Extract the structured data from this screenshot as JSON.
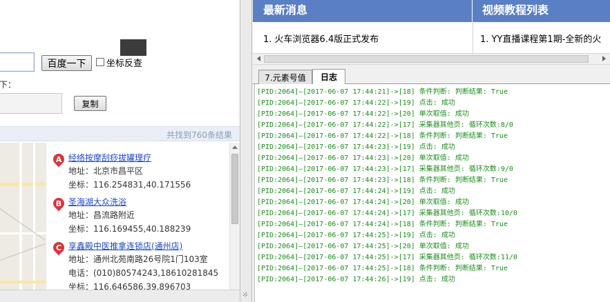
{
  "left": {
    "search_button": "百度一下",
    "reverse_checkbox_label": "坐标反查",
    "result_prefix": "下：",
    "copy_button": "复制",
    "result_count": "共找到760条结果",
    "results": [
      {
        "marker": "A",
        "title": "经络按摩刮痧拔罐理疗",
        "lines": [
          "地址：北京市昌平区",
          "坐标：116.254831,40.171556"
        ]
      },
      {
        "marker": "B",
        "title": "圣海湖大众洗浴",
        "lines": [
          "地址：昌流路附近",
          "坐标：116.169455,40.188239"
        ]
      },
      {
        "marker": "C",
        "title": "享鑫殿中医推拿连锁店(通州店)",
        "lines": [
          "地址：通州北苑南路26号院1门103室",
          "电话：(010)80574243,18610281845",
          "坐标：116.646586,39.896703"
        ]
      }
    ]
  },
  "right": {
    "news_header": "最新消息",
    "video_header": "视频教程列表",
    "news_item": "1. 火车浏览器6.4版正式发布",
    "video_item": "1. YY直播课程第1期-全新的火",
    "tabs": [
      {
        "label": "7.元素号值",
        "active": false
      },
      {
        "label": "日志",
        "active": true
      }
    ],
    "log_lines": [
      "[PID:2064]—[2017-06-07 17:44:21]->[18] 条件判断: 判断结果: True",
      "[PID:2064]—[2017-06-07 17:44:22]->[19] 点击: 成功",
      "[PID:2064]—[2017-06-07 17:44:22]->[20] 单次取值: 成功",
      "[PID:2064]—[2017-06-07 17:44:22]->[17] 采集器其他页: 循环次数:8/0",
      "[PID:2064]—[2017-06-07 17:44:22]->[18] 条件判断: 判断结果: True",
      "[PID:2064]—[2017-06-07 17:44:23]->[19] 点击: 成功",
      "[PID:2064]—[2017-06-07 17:44:23]->[20] 单次取值: 成功",
      "[PID:2064]—[2017-06-07 17:44:23]->[17] 采集器其他页: 循环次数:9/0",
      "[PID:2064]—[2017-06-07 17:44:23]->[18] 条件判断: 判断结果: True",
      "[PID:2064]—[2017-06-07 17:44:24]->[19] 点击: 成功",
      "[PID:2064]—[2017-06-07 17:44:24]->[20] 单次取值: 成功",
      "[PID:2064]—[2017-06-07 17:44:24]->[17] 采集器其他页: 循环次数:10/0",
      "[PID:2064]—[2017-06-07 17:44:24]->[18] 条件判断: 判断结果: True",
      "[PID:2064]—[2017-06-07 17:44:25]->[19] 点击: 成功",
      "[PID:2064]—[2017-06-07 17:44:25]->[20] 单次取值: 成功",
      "[PID:2064]—[2017-06-07 17:44:25]->[17] 采集器其他页: 循环次数:11/0",
      "[PID:2064]—[2017-06-07 17:44:25]->[18] 条件判断: 判断结果: True",
      "[PID:2064]—[2017-06-07 17:44:26]->[19] 点击: 成功"
    ]
  },
  "colors": {
    "header_blue": "#5a7fc4",
    "log_green": "#1b8b1b",
    "link_blue": "#1d46c4",
    "marker_red": "#d6363d"
  }
}
